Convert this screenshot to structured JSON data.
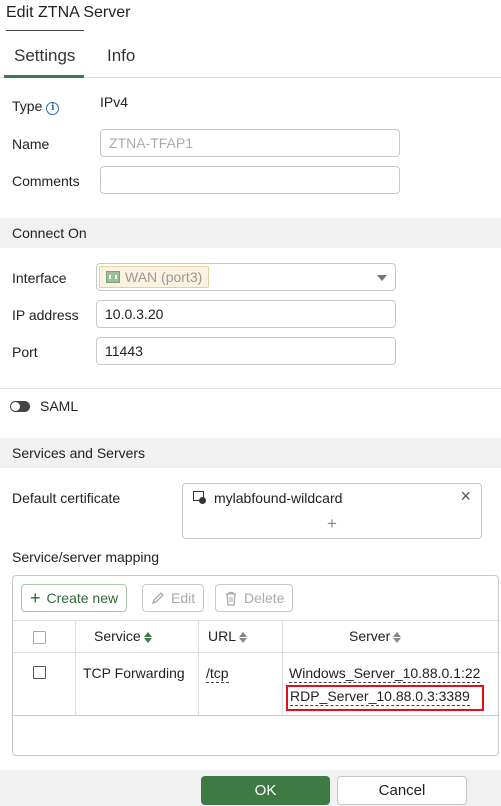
{
  "dialog": {
    "title": "Edit ZTNA Server"
  },
  "tabs": [
    {
      "label": "Settings",
      "active": true
    },
    {
      "label": "Info",
      "active": false
    }
  ],
  "form": {
    "type_label": "Type",
    "type_value": "IPv4",
    "name_label": "Name",
    "name_value": "ZTNA-TFAP1",
    "comments_label": "Comments",
    "comments_value": ""
  },
  "connect_on": {
    "header": "Connect On",
    "interface_label": "Interface",
    "interface_value": "WAN (port3)",
    "ip_label": "IP address",
    "ip_value": "10.0.3.20",
    "port_label": "Port",
    "port_value": "11443"
  },
  "saml": {
    "label": "SAML",
    "enabled": false
  },
  "services": {
    "header": "Services and Servers",
    "default_cert_label": "Default certificate",
    "default_cert_value": "mylabfound-wildcard",
    "add_symbol": "+",
    "remove_symbol": "×",
    "mapping_label": "Service/server mapping",
    "toolbar": {
      "create_label": "Create new",
      "edit_label": "Edit",
      "delete_label": "Delete"
    },
    "columns": {
      "service": "Service",
      "url": "URL",
      "server": "Server"
    },
    "rows": [
      {
        "service": "TCP Forwarding",
        "url": "/tcp",
        "servers": [
          "Windows_Server_10.88.0.1:22",
          "RDP_Server_10.88.0.3:3389"
        ]
      }
    ]
  },
  "footer": {
    "ok_label": "OK",
    "cancel_label": "Cancel"
  },
  "colors": {
    "accent": "#3e7a44",
    "highlight": "#e0101a",
    "info": "#2d6db5"
  }
}
